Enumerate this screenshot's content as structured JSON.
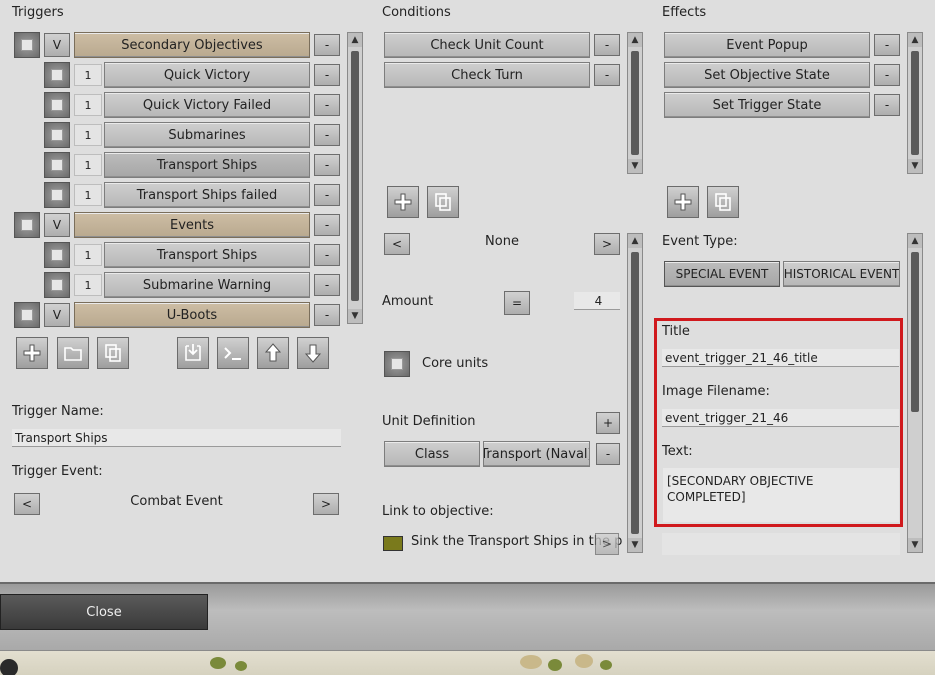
{
  "triggers": {
    "header": "Triggers",
    "list": [
      {
        "kind": "group",
        "toggle": "V",
        "label": "Secondary Objectives",
        "remove": "-"
      },
      {
        "kind": "item",
        "count": "1",
        "label": "Quick Victory",
        "remove": "-"
      },
      {
        "kind": "item",
        "count": "1",
        "label": "Quick Victory Failed",
        "remove": "-"
      },
      {
        "kind": "item",
        "count": "1",
        "label": "Submarines",
        "remove": "-"
      },
      {
        "kind": "item",
        "count": "1",
        "label": "Transport Ships",
        "remove": "-"
      },
      {
        "kind": "item",
        "count": "1",
        "label": "Transport Ships failed",
        "remove": "-"
      },
      {
        "kind": "group",
        "toggle": "V",
        "label": "Events",
        "remove": "-"
      },
      {
        "kind": "item",
        "count": "1",
        "label": "Transport Ships",
        "remove": "-"
      },
      {
        "kind": "item",
        "count": "1",
        "label": "Submarine Warning",
        "remove": "-"
      },
      {
        "kind": "group",
        "toggle": "V",
        "label": "U-Boots",
        "remove": "-"
      }
    ],
    "toolbar_icons": [
      "add-icon",
      "folder-icon",
      "copy-icon",
      "import-icon",
      "console-icon",
      "move-up-icon",
      "move-down-icon"
    ],
    "name_label": "Trigger Name:",
    "name_value": "Transport Ships",
    "event_label": "Trigger Event:",
    "event_value": "Combat Event",
    "prev": "<",
    "next": ">"
  },
  "conditions": {
    "header": "Conditions",
    "list": [
      {
        "label": "Check Unit Count",
        "remove": "-"
      },
      {
        "label": "Check Turn",
        "remove": "-"
      }
    ],
    "selector_value": "None",
    "prev": "<",
    "next": ">",
    "amount_label": "Amount",
    "amount_operator": "=",
    "amount_value": "4",
    "core_units_label": "Core units",
    "unit_def_label": "Unit Definition",
    "unit_def_add": "+",
    "unit_def_class": "Class",
    "unit_def_value": "Transport (Naval)",
    "unit_def_remove": "-",
    "link_label": "Link to objective:",
    "link_value": "Sink the Transport Ships in the port",
    "link_color": "#7a7a1c",
    "link_next": ">"
  },
  "effects": {
    "header": "Effects",
    "list": [
      {
        "label": "Event Popup",
        "remove": "-"
      },
      {
        "label": "Set Objective State",
        "remove": "-"
      },
      {
        "label": "Set Trigger State",
        "remove": "-"
      }
    ],
    "event_type_label": "Event Type:",
    "special_event": "SPECIAL EVENT",
    "historical_event": "HISTORICAL EVENT",
    "title_label": "Title",
    "title_value": "event_trigger_21_46_title",
    "image_label": "Image Filename:",
    "image_value": "event_trigger_21_46",
    "text_label": "Text:",
    "text_value": "[SECONDARY OBJECTIVE COMPLETED]",
    "highlight_color": "#d0191d"
  },
  "footer": {
    "close_label": "Close"
  }
}
